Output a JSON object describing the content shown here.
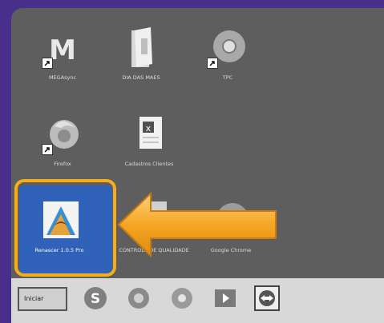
{
  "desktop": {
    "icons": [
      {
        "label": "MEGAsync"
      },
      {
        "label": "DIA DAS MAES"
      },
      {
        "label": "TPC"
      },
      {
        "label": "Firefox"
      },
      {
        "label": "Cadastros Clientes"
      },
      {
        "label": "Renascer 1.0.5 Pro"
      },
      {
        "label": "CONTROLE DE QUALIDADE"
      },
      {
        "label": "Google Chrome"
      }
    ]
  },
  "taskbar": {
    "start_label": "Iniciar",
    "apps": [
      "skype-icon",
      "ccleaner-icon",
      "chrome-icon",
      "media-player-icon",
      "teamviewer-icon"
    ]
  },
  "colors": {
    "highlight": "#f6ad1b",
    "selection": "#2f62b8",
    "desktop": "#5e5e5e",
    "frame": "#4a2e8c"
  }
}
